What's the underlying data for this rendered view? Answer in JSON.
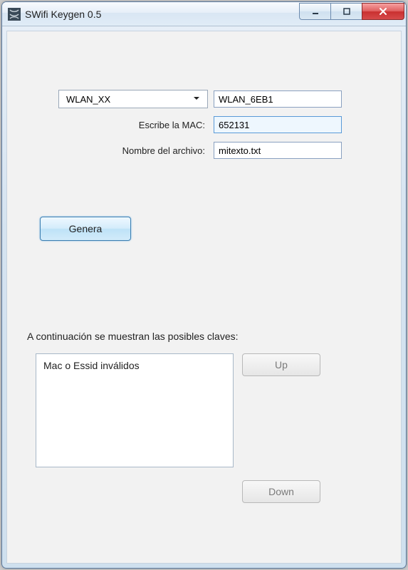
{
  "window": {
    "title": "SWifi Keygen 0.5"
  },
  "form": {
    "network_type_selected": "WLAN_XX",
    "ssid_value": "WLAN_6EB1",
    "mac_label": "Escribe la MAC:",
    "mac_value": "652131",
    "file_label": "Nombre del archivo:",
    "file_value": "mitexto.txt"
  },
  "actions": {
    "generate_label": "Genera",
    "up_label": "Up",
    "down_label": "Down"
  },
  "results": {
    "heading": "A continuación se muestran las posibles claves:",
    "message": "Mac o Essid inválidos"
  }
}
